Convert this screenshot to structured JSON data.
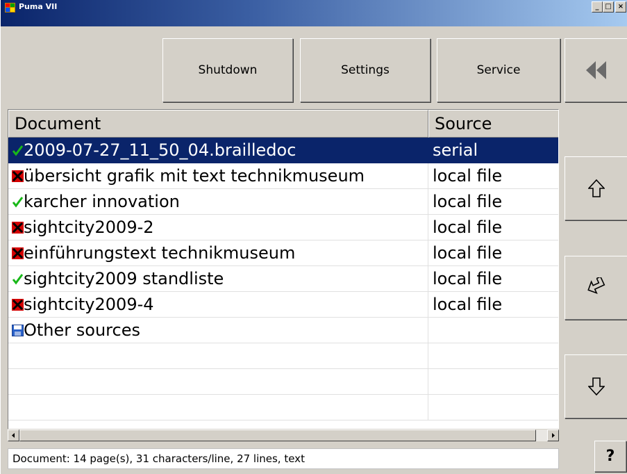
{
  "window": {
    "title": "Puma VII",
    "minimize_label": "_",
    "maximize_label": "□",
    "close_label": "×"
  },
  "toolbar": {
    "shutdown_label": "Shutdown",
    "settings_label": "Settings",
    "service_label": "Service"
  },
  "side_buttons": {
    "back": "rewind-icon",
    "up": "arrow-up-icon",
    "enter": "enter-icon",
    "down": "arrow-down-icon"
  },
  "list": {
    "columns": [
      "Document",
      "Source"
    ],
    "rows": [
      {
        "status": "check",
        "document": "2009-07-27_11_50_04.brailledoc",
        "source": "serial",
        "selected": true
      },
      {
        "status": "cross",
        "document": "übersicht grafik mit text technikmuseum",
        "source": "local file",
        "selected": false
      },
      {
        "status": "check",
        "document": "karcher innovation",
        "source": "local file",
        "selected": false
      },
      {
        "status": "cross",
        "document": "sightcity2009-2",
        "source": "local file",
        "selected": false
      },
      {
        "status": "cross",
        "document": "einführungstext technikmuseum",
        "source": "local file",
        "selected": false
      },
      {
        "status": "check",
        "document": "sightcity2009 standliste",
        "source": "local file",
        "selected": false
      },
      {
        "status": "cross",
        "document": "sightcity2009-4",
        "source": "local file",
        "selected": false
      },
      {
        "status": "disk",
        "document": "Other sources",
        "source": "",
        "selected": false
      }
    ]
  },
  "status_bar": {
    "text": "Document: 14 page(s), 31 characters/line, 27 lines, text"
  },
  "help": {
    "label": "?"
  },
  "colors": {
    "selection": "#0a246a",
    "check": "#18b818",
    "cross": "#d40000",
    "face": "#d4d0c8"
  }
}
